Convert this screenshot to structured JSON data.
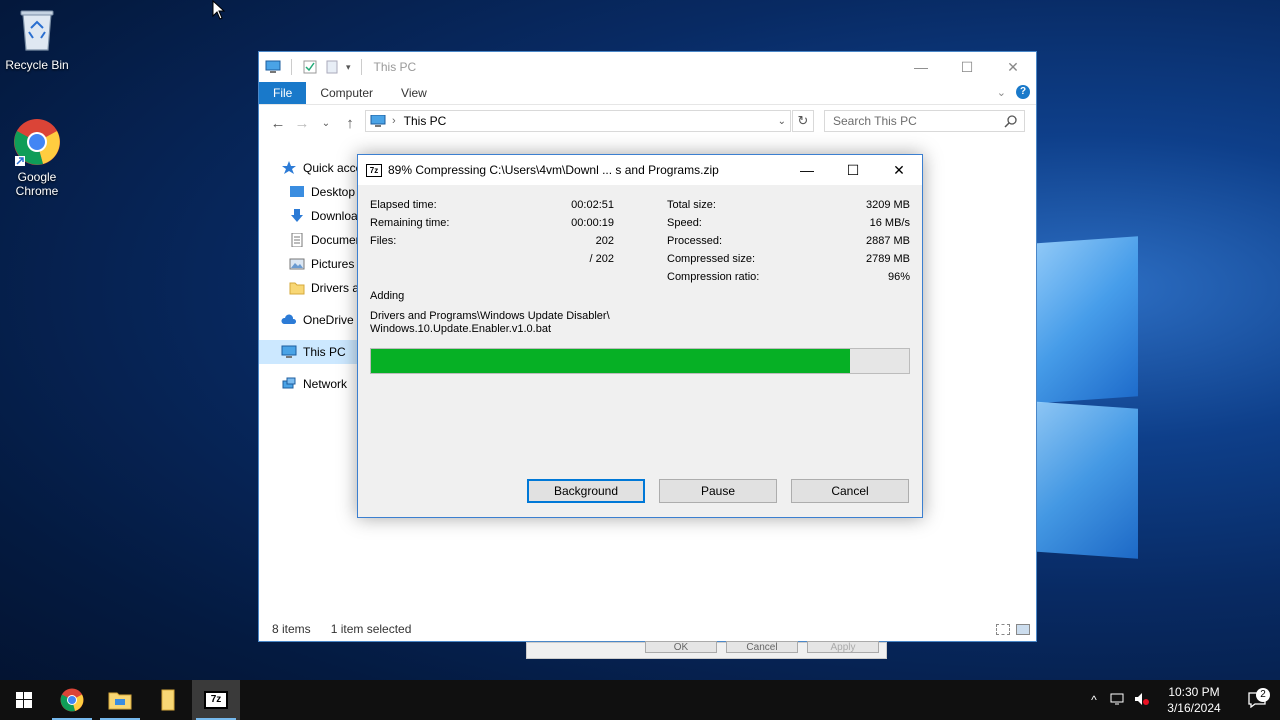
{
  "desktop": {
    "icons": [
      {
        "label": "Recycle Bin",
        "icon": "recycle-bin-icon"
      },
      {
        "label": "Google\nChrome",
        "icon": "chrome-icon"
      }
    ]
  },
  "explorer": {
    "title": "This PC",
    "ribbon_tabs": [
      "File",
      "Computer",
      "View"
    ],
    "address": "This PC",
    "search_placeholder": "Search This PC",
    "nav_items": [
      {
        "label": "Quick access",
        "icon": "star-icon"
      },
      {
        "label": "Desktop",
        "icon": "desktop-folder-icon"
      },
      {
        "label": "Downloads",
        "icon": "download-arrow-icon"
      },
      {
        "label": "Documents",
        "icon": "documents-icon"
      },
      {
        "label": "Pictures",
        "icon": "pictures-icon"
      },
      {
        "label": "Drivers and Programs",
        "icon": "folder-icon"
      },
      {
        "label": "OneDrive",
        "icon": "cloud-icon"
      },
      {
        "label": "This PC",
        "icon": "computer-icon"
      },
      {
        "label": "Network",
        "icon": "network-icon"
      }
    ],
    "status_items": "8 items",
    "status_selected": "1 item selected"
  },
  "zip_dialog": {
    "title": "89% Compressing C:\\Users\\4vm\\Downl ... s and Programs.zip",
    "progress_fraction": 0.89,
    "left_stats": [
      {
        "label": "Elapsed time:",
        "value": "00:02:51"
      },
      {
        "label": "Remaining time:",
        "value": "00:00:19"
      },
      {
        "label": "Files:",
        "value": "202"
      },
      {
        "label": "",
        "value": "/ 202"
      }
    ],
    "right_stats": [
      {
        "label": "Total size:",
        "value": "3209 MB"
      },
      {
        "label": "Speed:",
        "value": "16 MB/s"
      },
      {
        "label": "Processed:",
        "value": "2887 MB"
      },
      {
        "label": "Compressed size:",
        "value": "2789 MB"
      },
      {
        "label": "Compression ratio:",
        "value": "96%"
      }
    ],
    "adding_label": "Adding",
    "current_path_line1": "Drivers and Programs\\Windows Update Disabler\\",
    "current_path_line2": "Windows.10.Update.Enabler.v1.0.bat",
    "buttons": {
      "background": "Background",
      "pause": "Pause",
      "cancel": "Cancel"
    }
  },
  "under_dialog": {
    "ok": "OK",
    "cancel": "Cancel",
    "apply": "Apply"
  },
  "taskbar": {
    "time": "10:30 PM",
    "date": "3/16/2024",
    "notification_count": "2",
    "pinned": [
      "start-icon",
      "chrome-icon",
      "file-explorer-icon",
      "notepad-icon",
      "7zip-icon"
    ]
  },
  "colors": {
    "accent": "#1979ca",
    "progress": "#06b025",
    "taskbar": "#101010"
  }
}
